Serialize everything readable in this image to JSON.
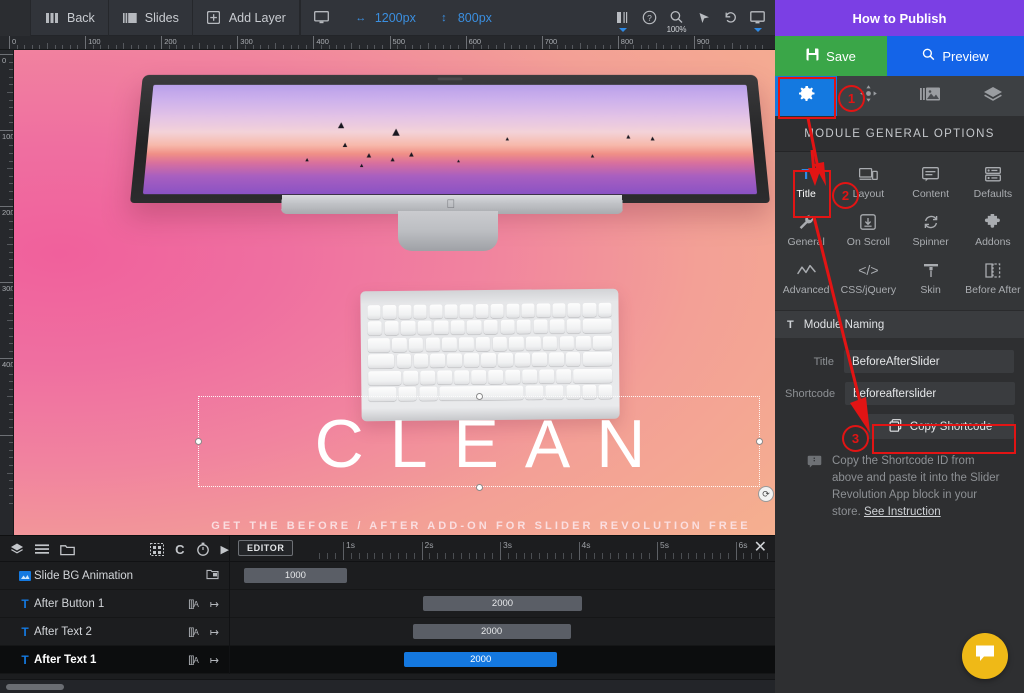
{
  "toolbar": {
    "items": [
      {
        "label": "Back",
        "icon": "columns-icon"
      },
      {
        "label": "Slides",
        "icon": "slides-icon"
      },
      {
        "label": "Add Layer",
        "icon": "add-layer-icon"
      }
    ],
    "device_icon": "desktop-icon",
    "width_value": "1200px",
    "height_value": "800px",
    "right_icons": [
      {
        "name": "grid-snap-icon",
        "glyph": "⌶"
      },
      {
        "name": "help-icon",
        "glyph": "?"
      },
      {
        "name": "zoom-icon",
        "glyph": "⌕"
      },
      {
        "name": "cursor-icon",
        "glyph": "➤"
      },
      {
        "name": "undo-icon",
        "glyph": "↺"
      },
      {
        "name": "preview-device-icon",
        "glyph": "⬜"
      }
    ],
    "zoom_level": "100%"
  },
  "ruler": {
    "horizontal_labels": [
      "0",
      "100",
      "200",
      "300",
      "400",
      "500",
      "600",
      "700",
      "800",
      "900"
    ],
    "vertical_labels": [
      "0",
      "100",
      "200",
      "300",
      "400"
    ]
  },
  "canvas": {
    "headline": "CLEAN",
    "subline": "GET THE BEFORE / AFTER ADD-ON FOR SLIDER REVOLUTION FREE"
  },
  "timeline": {
    "editor_button": "EDITOR",
    "close_icon": "close-icon",
    "left_tools": [
      {
        "name": "layers-icon",
        "glyph": "◆"
      },
      {
        "name": "list-icon",
        "glyph": "≡"
      },
      {
        "name": "folder-icon",
        "glyph": "▭"
      }
    ],
    "right_tools": [
      {
        "name": "snap-grid-icon",
        "glyph": "▒"
      },
      {
        "name": "loop-icon",
        "glyph": "C"
      },
      {
        "name": "stopwatch-icon",
        "glyph": "⏱"
      },
      {
        "name": "play-icon",
        "glyph": "▶"
      }
    ],
    "time_labels": [
      "1s",
      "2s",
      "3s",
      "4s",
      "5s",
      "6s"
    ],
    "rows": [
      {
        "name": "Slide BG Animation",
        "icon": "image-layer-icon",
        "duration": "1000",
        "start_pct": 0,
        "width_pct": 19,
        "selected": false,
        "type": "bg",
        "right_icon": "copy-icon"
      },
      {
        "name": "After Button 1",
        "icon": "text-layer-icon",
        "duration": "2000",
        "start_pct": 33,
        "width_pct": 29,
        "selected": false,
        "type": "text"
      },
      {
        "name": "After Text 2",
        "icon": "text-layer-icon",
        "duration": "2000",
        "start_pct": 31.5,
        "width_pct": 29,
        "selected": false,
        "type": "text"
      },
      {
        "name": "After Text 1",
        "icon": "text-layer-icon",
        "duration": "2000",
        "start_pct": 30,
        "width_pct": 28,
        "selected": true,
        "type": "text"
      }
    ]
  },
  "right_panel": {
    "title": "How to Publish",
    "save_label": "Save",
    "preview_label": "Preview",
    "tabs": [
      {
        "name": "settings",
        "icon": "gear-icon",
        "active": true
      },
      {
        "name": "move",
        "icon": "move-icon",
        "active": false
      },
      {
        "name": "slides",
        "icon": "slides-gallery-icon",
        "active": false
      },
      {
        "name": "layers",
        "icon": "layers-diamond-icon",
        "active": false
      }
    ],
    "section_header": "MODULE GENERAL OPTIONS",
    "options": [
      {
        "label": "Title",
        "icon": "title-icon",
        "active": true
      },
      {
        "label": "Layout",
        "icon": "layout-icon",
        "active": false
      },
      {
        "label": "Content",
        "icon": "content-icon",
        "active": false
      },
      {
        "label": "Defaults",
        "icon": "defaults-icon",
        "active": false
      },
      {
        "label": "General",
        "icon": "wrench-icon",
        "active": false
      },
      {
        "label": "On Scroll",
        "icon": "on-scroll-icon",
        "active": false
      },
      {
        "label": "Spinner",
        "icon": "spinner-icon",
        "active": false
      },
      {
        "label": "Addons",
        "icon": "puzzle-icon",
        "active": false
      },
      {
        "label": "Advanced",
        "icon": "advanced-icon",
        "active": false
      },
      {
        "label": "CSS/jQuery",
        "icon": "code-icon",
        "active": false
      },
      {
        "label": "Skin",
        "icon": "skin-icon",
        "active": false
      },
      {
        "label": "Before After",
        "icon": "before-after-icon",
        "active": false
      }
    ],
    "module_naming_header": "Module Naming",
    "module_naming_icon": "title-icon",
    "fields": [
      {
        "label": "Title",
        "value": "BeforeAfterSlider"
      },
      {
        "label": "Shortcode",
        "value": "beforeafterslider"
      }
    ],
    "copy_button": "Copy Shortcode",
    "copy_icon": "copy-icon",
    "help_icon": "note-icon",
    "help_text": "Copy the Shortcode ID from above and paste it into the Slider Revolution App block in your store.",
    "help_link": "See Instruction"
  },
  "annotations": {
    "steps": [
      "1",
      "2",
      "3"
    ],
    "color": "#e21414"
  },
  "chat": {
    "icon": "chat-bubble-icon",
    "color": "#efb917"
  }
}
